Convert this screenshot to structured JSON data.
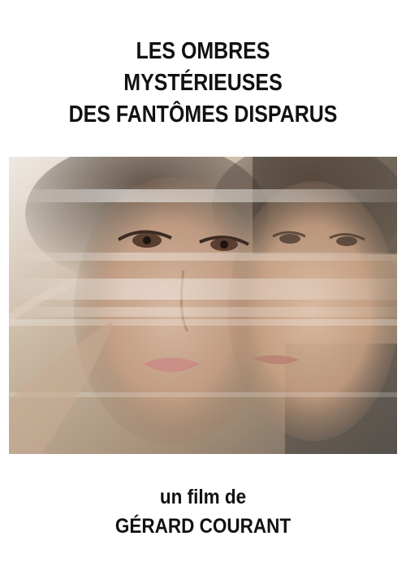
{
  "poster": {
    "title_lines": [
      "LES OMBRES",
      "MYSTÉRIEUSES",
      "DES FANTÔMES DISPARUS"
    ],
    "credit_lines": [
      "un film de",
      "GÉRARD COURANT"
    ],
    "colors": {
      "background": "#ffffff",
      "text": "#111111"
    }
  }
}
